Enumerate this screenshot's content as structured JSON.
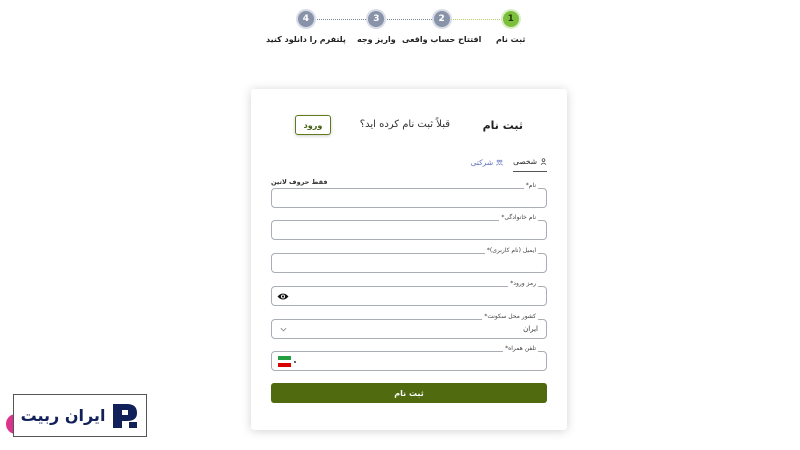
{
  "stepper": {
    "steps": [
      {
        "number": "1",
        "label": "ثبت نام"
      },
      {
        "number": "2",
        "label": "افتتاح حساب واقعی"
      },
      {
        "number": "3",
        "label": "واریز وجه"
      },
      {
        "number": "4",
        "label": "پلتفرم را دانلود کنید"
      }
    ],
    "active_step": 1
  },
  "card": {
    "title": "ثبت نام",
    "already_registered": "قبلاً ثبت نام کرده اید؟",
    "login_label": "ورود",
    "tabs": [
      {
        "label": "شخصی",
        "icon": "person-icon",
        "active": true
      },
      {
        "label": "شرکتی",
        "icon": "company-icon",
        "active": false
      }
    ],
    "latin_note": "فقط حروف لاتین",
    "fields": {
      "first_name": {
        "label": "نام*",
        "value": ""
      },
      "last_name": {
        "label": "نام خانوادگی*",
        "value": ""
      },
      "email": {
        "label": "ایمیل (نام کاربری)*",
        "value": ""
      },
      "password": {
        "label": "رمز ورود*",
        "value": ""
      },
      "country": {
        "label": "کشور محل سکونت*",
        "value": "ایران"
      },
      "phone": {
        "label": "تلفن همراه*",
        "value": ""
      }
    },
    "submit_label": "ثبت نام"
  },
  "logo": {
    "text": "ایران ربیت"
  },
  "colors": {
    "accent": "#4f6a0f",
    "active_step": "#7cbf3c",
    "inactive_step": "#8893aa",
    "logo_text": "#12205a",
    "pink": "#d9338c"
  }
}
